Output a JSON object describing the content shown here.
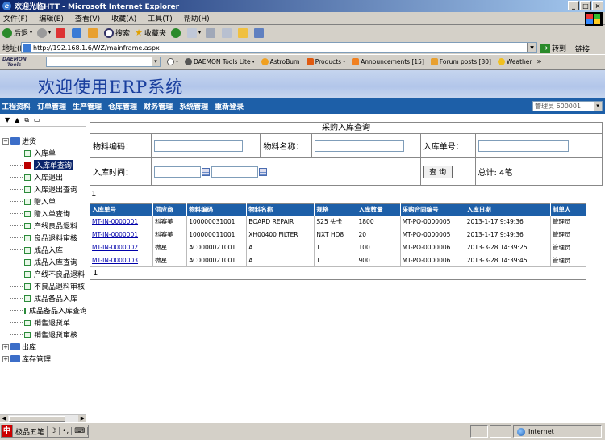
{
  "window": {
    "title": "欢迎光临HTT - Microsoft Internet Explorer"
  },
  "menu": [
    "文件(F)",
    "编辑(E)",
    "查看(V)",
    "收藏(A)",
    "工具(T)",
    "帮助(H)"
  ],
  "toolbar": {
    "back": "后退",
    "search": "搜索",
    "favorites": "收藏夹"
  },
  "address": {
    "label": "地址(D)",
    "url": "http://192.168.1.6/WZ/mainframe.aspx",
    "go": "转到",
    "links": "链接"
  },
  "daemon": {
    "logo_line1": "DAEMON",
    "logo_line2": "Tools",
    "items": [
      "DAEMON Tools Lite",
      "AstroBurn",
      "Products",
      "Announcements [15]",
      "Forum posts [30]",
      "Weather"
    ]
  },
  "app": {
    "title": "欢迎使用ERP系统",
    "nav": [
      "工程资料",
      "订单管理",
      "生产管理",
      "仓库管理",
      "财务管理",
      "系统管理",
      "重新登录"
    ],
    "user": "管理员 600001"
  },
  "sidebar": {
    "root": "进货",
    "items": [
      "入库单",
      "入库单查询",
      "入库退出",
      "入库退出查询",
      "赠入单",
      "赠入单查询",
      "产线良品退料",
      "良品退料审核",
      "成品入库",
      "成品入库查询",
      "产线不良品退料",
      "不良品退料审核",
      "成品备品入库",
      "成品备品入库查询",
      "销售退货单",
      "销售退货审核"
    ],
    "others": [
      "出库",
      "库存管理"
    ]
  },
  "query": {
    "title": "采购入库查询",
    "material_code_label": "物料编码：",
    "material_name_label": "物料名称：",
    "inbound_no_label": "入库单号：",
    "inbound_time_label": "入库时间：",
    "search_button": "查 询",
    "total": "总计: 4笔"
  },
  "pager_top": "1",
  "pager_bottom": "1",
  "table": {
    "columns": [
      "入库单号",
      "供应商",
      "物料编码",
      "物料名称",
      "规格",
      "入库数量",
      "采购合同编号",
      "入库日期",
      "制单人"
    ],
    "rows": [
      [
        "MT-IN-0000001",
        "科赛美",
        "100000031001",
        "BOARD REPAIR",
        "S25 头卡",
        "1800",
        "MT-PO-0000005",
        "2013-1-17 9:49:36",
        "管理员"
      ],
      [
        "MT-IN-0000001",
        "科赛美",
        "100000011001",
        "XH00400 FILTER",
        "NXT HD8",
        "20",
        "MT-PO-0000005",
        "2013-1-17 9:49:36",
        "管理员"
      ],
      [
        "MT-IN-0000002",
        "微星",
        "AC0000021001",
        "A",
        "T",
        "100",
        "MT-PO-0000006",
        "2013-3-28 14:39:25",
        "管理员"
      ],
      [
        "MT-IN-0000003",
        "微星",
        "AC0000021001",
        "A",
        "T",
        "900",
        "MT-PO-0000006",
        "2013-3-28 14:39:45",
        "管理员"
      ]
    ]
  },
  "status": {
    "ime": [
      "中",
      "极品五笔",
      "☽",
      "•,",
      "⌨"
    ],
    "zone": "Internet"
  }
}
